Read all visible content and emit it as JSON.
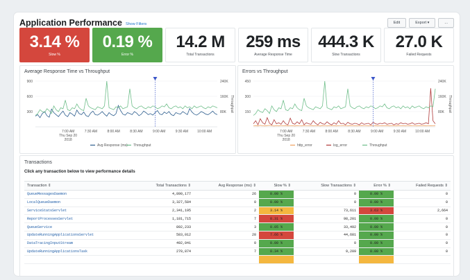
{
  "header": {
    "title": "Application Performance",
    "show_filters": "Show Filters",
    "edit_label": "Edit",
    "export_label": "Export ▾",
    "more_label": "..."
  },
  "kpis": [
    {
      "value": "3.14 %",
      "label": "Slow %",
      "status": "red"
    },
    {
      "value": "0.19 %",
      "label": "Error %",
      "status": "green"
    },
    {
      "value": "14.2 M",
      "label": "Total Transactions",
      "status": "none"
    },
    {
      "value": "259 ms",
      "label": "Average Response Time",
      "status": "none"
    },
    {
      "value": "444.3 K",
      "label": "Slow Transactions",
      "status": "none"
    },
    {
      "value": "27.0 K",
      "label": "Failed Requests",
      "status": "none"
    }
  ],
  "colors": {
    "red": "#d4473d",
    "green": "#55a84d",
    "yellow": "#f4b73f",
    "avg_response": "#2f5f8f",
    "throughput": "#6fbe8a",
    "http_error": "#f0a25e",
    "log_error": "#b03a3a",
    "marker": "#3a55c8"
  },
  "chart_data": [
    {
      "type": "line",
      "title": "Average Response Time vs Throughput",
      "x_ticks": [
        "7:00 AM\nThu Sep 20\n2018",
        "7:30 AM",
        "8:00 AM",
        "8:30 AM",
        "9:00 AM",
        "9:30 AM",
        "10:00 AM"
      ],
      "y_left_ticks": [
        "900",
        "600",
        "300"
      ],
      "y_right_ticks": [
        "240K",
        "160K",
        "80K"
      ],
      "ylim_left": [
        0,
        900
      ],
      "ylim_right": [
        0,
        240000
      ],
      "y_right_label": "Throughput",
      "legend_position": "bottom",
      "series": [
        {
          "name": "Avg Response (ms)",
          "axis": "left",
          "values": [
            210,
            240,
            180,
            260,
            300,
            220,
            190,
            350,
            280,
            240,
            200,
            260,
            310,
            230,
            200,
            280,
            250,
            210,
            330,
            260,
            240,
            290,
            220,
            200,
            270,
            310,
            240,
            230,
            260,
            300,
            250,
            210,
            280,
            240,
            220,
            260,
            420,
            320,
            250,
            230,
            280,
            260,
            240,
            300,
            270,
            220,
            250,
            310,
            280,
            240,
            260,
            230,
            280,
            320,
            250,
            240,
            290,
            260,
            300,
            240,
            220,
            280,
            260,
            250,
            300,
            270,
            240,
            360,
            290,
            250,
            230,
            260,
            300,
            280,
            250,
            240,
            270,
            310,
            260,
            240
          ]
        },
        {
          "name": "Throughput",
          "axis": "right",
          "values": [
            60000,
            70000,
            90000,
            80000,
            75000,
            95000,
            85000,
            70000,
            110000,
            90000,
            80000,
            100000,
            95000,
            140000,
            90000,
            85000,
            100000,
            95000,
            120000,
            100000,
            90000,
            85000,
            150000,
            110000,
            100000,
            95000,
            90000,
            105000,
            100000,
            95000,
            110000,
            240000,
            100000,
            95000,
            90000,
            105000,
            100000,
            110000,
            95000,
            100000,
            105000,
            200000,
            110000,
            100000,
            95000,
            105000,
            110000,
            100000,
            95000,
            105000,
            100000,
            110000,
            105000,
            95000,
            100000,
            110000,
            105000,
            120000,
            100000,
            95000,
            105000,
            110000,
            100000,
            105000,
            95000,
            110000,
            100000,
            105000,
            95000,
            110000,
            100000,
            105000,
            110000,
            100000,
            95000,
            105000,
            100000,
            110000,
            105000,
            100000
          ]
        }
      ],
      "marker_index": 52
    },
    {
      "type": "line",
      "title": "Errors vs Throughput",
      "x_ticks": [
        "7:00 AM\nThu Sep 20\n2018",
        "7:30 AM",
        "8:00 AM",
        "8:30 AM",
        "9:00 AM",
        "9:30 AM",
        "10:00 AM"
      ],
      "y_left_ticks": [
        "450",
        "300",
        "150"
      ],
      "y_right_ticks": [
        "240K",
        "160K",
        "80K"
      ],
      "ylim_left": [
        0,
        450
      ],
      "ylim_right": [
        0,
        240000
      ],
      "y_right_label": "Throughput",
      "legend_position": "bottom",
      "series": [
        {
          "name": "http_error",
          "axis": "left",
          "values": [
            10,
            12,
            8,
            15,
            10,
            9,
            12,
            14,
            10,
            8,
            11,
            9,
            13,
            10,
            12,
            9,
            10,
            11,
            8,
            12,
            10,
            9,
            13,
            11,
            10,
            12,
            9,
            10,
            11,
            8,
            12,
            10,
            9,
            11,
            10,
            12,
            9,
            10,
            11,
            13,
            10,
            9,
            12,
            10,
            11,
            9,
            10,
            12,
            11,
            10,
            9,
            11,
            10,
            12,
            9,
            10,
            11,
            10,
            12,
            9,
            10,
            11,
            9,
            12,
            10,
            11,
            9,
            10,
            12,
            11,
            10,
            9,
            11,
            10,
            12,
            9,
            10,
            11,
            10,
            12
          ]
        },
        {
          "name": "log_error",
          "axis": "left",
          "values": [
            30,
            60,
            20,
            80,
            40,
            25,
            90,
            35,
            20,
            70,
            30,
            40,
            25,
            60,
            30,
            20,
            85,
            35,
            25,
            50,
            30,
            70,
            20,
            40,
            30,
            25,
            60,
            35,
            20,
            45,
            30,
            25,
            50,
            30,
            20,
            40,
            25,
            60,
            30,
            35,
            20,
            45,
            30,
            25,
            35,
            30,
            20,
            40,
            25,
            30,
            35,
            20,
            45,
            30,
            25,
            35,
            30,
            40,
            25,
            30,
            35,
            20,
            30,
            25,
            40,
            30,
            35,
            25,
            30,
            40,
            25,
            30,
            35,
            25,
            30,
            40,
            30,
            380,
            60,
            30
          ]
        },
        {
          "name": "Throughput",
          "axis": "right",
          "values": [
            60000,
            70000,
            90000,
            80000,
            75000,
            95000,
            85000,
            70000,
            110000,
            90000,
            80000,
            100000,
            95000,
            140000,
            90000,
            85000,
            100000,
            95000,
            120000,
            100000,
            90000,
            85000,
            150000,
            110000,
            100000,
            95000,
            90000,
            105000,
            100000,
            95000,
            110000,
            240000,
            100000,
            95000,
            90000,
            105000,
            100000,
            110000,
            95000,
            100000,
            105000,
            200000,
            110000,
            100000,
            95000,
            105000,
            110000,
            100000,
            95000,
            105000,
            100000,
            110000,
            105000,
            95000,
            100000,
            110000,
            105000,
            120000,
            100000,
            95000,
            105000,
            110000,
            100000,
            105000,
            95000,
            110000,
            100000,
            105000,
            95000,
            110000,
            100000,
            105000,
            110000,
            100000,
            95000,
            105000,
            100000,
            110000,
            105000,
            200000
          ]
        }
      ],
      "marker_index": 52
    }
  ],
  "transactions": {
    "title": "Transactions",
    "subtitle": "Click any transaction below to view performance details",
    "columns": [
      "Transaction ⇕",
      "Total Transactions ⇕",
      "Avg Response (ms) ⇕",
      "Slow % ⇕",
      "Slow Transactions ⇕",
      "Error % ⇕",
      "Failed Requests ⇕"
    ],
    "rows": [
      {
        "name": "QueueMessagesDaemon",
        "total": "4,890,177",
        "avg": "26",
        "slow_pct": "0.00 %",
        "slow_status": "green",
        "slow_tx": "0",
        "err_pct": "0.00 %",
        "err_status": "green",
        "failed": "0"
      },
      {
        "name": "LocalQueueDaemon",
        "total": "3,327,584",
        "avg": "0",
        "slow_pct": "0.00 %",
        "slow_status": "green",
        "slow_tx": "0",
        "err_pct": "0.00 %",
        "err_status": "green",
        "failed": "0"
      },
      {
        "name": "ServiceStatsServlet",
        "total": "2,341,195",
        "avg": "2",
        "slow_pct": "3.14 %",
        "slow_status": "yellow",
        "slow_tx": "73,611",
        "err_pct": "3.63 %",
        "err_status": "red",
        "failed": "2,664"
      },
      {
        "name": "ReportProcessesServlet",
        "total": "1,181,715",
        "avg": "7",
        "slow_pct": "8.31 %",
        "slow_status": "red",
        "slow_tx": "98,201",
        "err_pct": "0.00 %",
        "err_status": "green",
        "failed": "0"
      },
      {
        "name": "QueueService",
        "total": "892,233",
        "avg": "3",
        "slow_pct": "0.05 %",
        "slow_status": "green",
        "slow_tx": "33,492",
        "err_pct": "0.00 %",
        "err_status": "green",
        "failed": "0"
      },
      {
        "name": "UpdateRunningApplicationsServlet",
        "total": "583,012",
        "avg": "28",
        "slow_pct": "7.66 %",
        "slow_status": "red",
        "slow_tx": "44,681",
        "err_pct": "0.00 %",
        "err_status": "green",
        "failed": "0"
      },
      {
        "name": "DataTracingInputStream",
        "total": "492,041",
        "avg": "0",
        "slow_pct": "0.00 %",
        "slow_status": "green",
        "slow_tx": "0",
        "err_pct": "0.00 %",
        "err_status": "green",
        "failed": "0"
      },
      {
        "name": "UpdateRunningApplicationsTask",
        "total": "270,874",
        "avg": "7",
        "slow_pct": "0.34 %",
        "slow_status": "green",
        "slow_tx": "9,209",
        "err_pct": "0.00 %",
        "err_status": "green",
        "failed": "0"
      },
      {
        "name": "",
        "total": "",
        "avg": "",
        "slow_pct": "",
        "slow_status": "yellow",
        "slow_tx": "",
        "err_pct": "",
        "err_status": "yellow",
        "failed": ""
      }
    ]
  }
}
